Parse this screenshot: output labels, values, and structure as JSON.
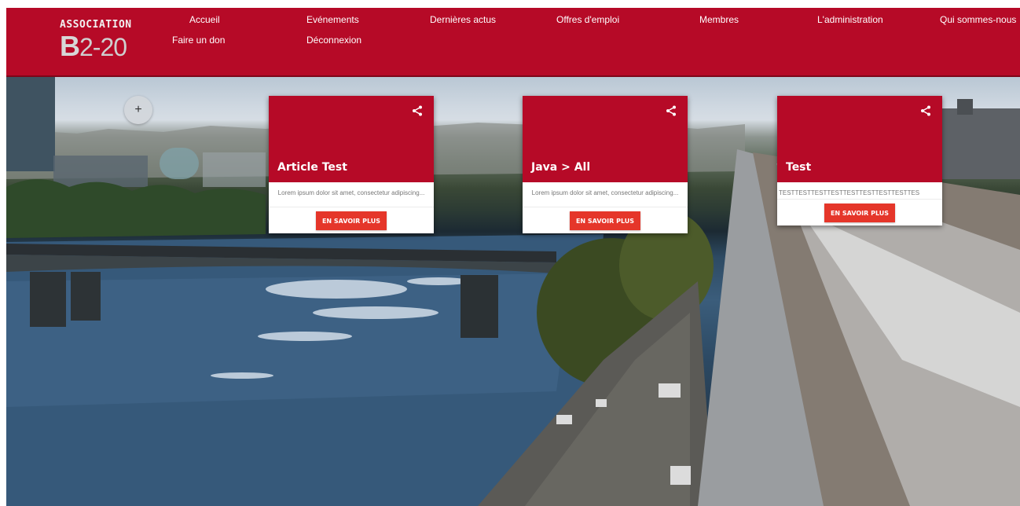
{
  "logo": {
    "top_text": "ASSOCIATION",
    "bottom_first": "B",
    "bottom_rest": "2-20"
  },
  "nav": {
    "accueil": "Accueil",
    "evenements": "Evénements",
    "actus": "Dernières actus",
    "offres": "Offres d'emploi",
    "membres": "Membres",
    "administration": "L'administration",
    "qui": "Qui sommes-nous",
    "don": "Faire un don",
    "deconnexion": "Déconnexion"
  },
  "hero": {
    "add_button": "+"
  },
  "cards": [
    {
      "title": "Article Test",
      "excerpt": "Lorem ipsum dolor sit amet, consectetur adipiscing...",
      "button": "EN SAVOIR PLUS"
    },
    {
      "title": "Java > All",
      "excerpt": "Lorem ipsum dolor sit amet, consectetur adipiscing...",
      "button": "EN SAVOIR PLUS"
    },
    {
      "title": "Test",
      "excerpt": "TESTTESTTESTTESTTESTTESTTESTTESTTES",
      "button": "EN SAVOIR PLUS"
    }
  ],
  "colors": {
    "brand_red": "#b60a27",
    "button_red": "#e5362a"
  },
  "icons": {
    "share": "share-icon",
    "add": "plus-icon"
  }
}
